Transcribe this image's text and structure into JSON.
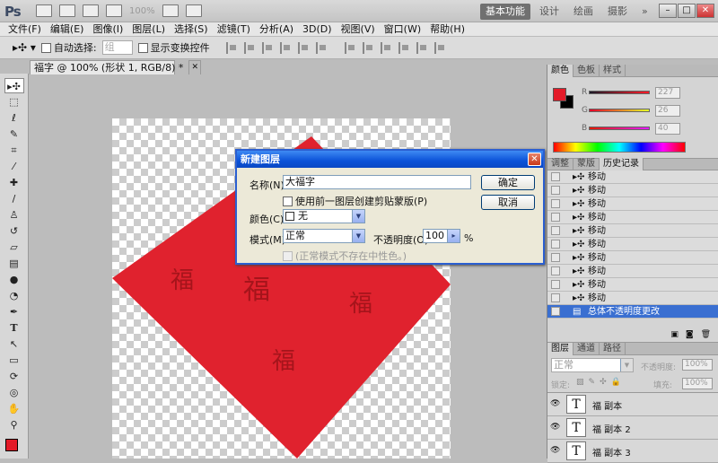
{
  "app": {
    "logo": "Ps",
    "zoom": "100%"
  },
  "workspaces": [
    "基本功能",
    "设计",
    "绘画",
    "摄影"
  ],
  "workspace_more": "»",
  "window_controls": [
    "–",
    "□",
    "✕"
  ],
  "menu": [
    "文件(F)",
    "编辑(E)",
    "图像(I)",
    "图层(L)",
    "选择(S)",
    "滤镜(T)",
    "分析(A)",
    "3D(D)",
    "视图(V)",
    "窗口(W)",
    "帮助(H)"
  ],
  "options": {
    "auto_select_label": "自动选择:",
    "auto_select_value": "组",
    "transform_label": "显示变换控件"
  },
  "document": {
    "tab_title": "福字 @ 100% (形状 1, RGB/8) *",
    "close": "✕"
  },
  "canvas": {
    "fu_char": "福",
    "shape_color": "#e0222e"
  },
  "dialog": {
    "title": "新建图层",
    "close": "✕",
    "name_label": "名称(N):",
    "name_value": "大福字",
    "clip_label": "使用前一图层创建剪贴蒙版(P)",
    "color_label": "颜色(C):",
    "color_value": "无",
    "mode_label": "模式(M):",
    "mode_value": "正常",
    "opacity_label": "不透明度(O):",
    "opacity_value": "100",
    "opacity_unit": "%",
    "neutral_label": "(正常模式不存在中性色。)",
    "ok": "确定",
    "cancel": "取消"
  },
  "color_panel": {
    "tabs": [
      "颜色",
      "色板",
      "样式"
    ],
    "channels": [
      {
        "label": "R",
        "value": "227"
      },
      {
        "label": "G",
        "value": "26"
      },
      {
        "label": "B",
        "value": "40"
      }
    ],
    "fg": "#e31a28",
    "bg": "#000000"
  },
  "history_panel": {
    "tabs": [
      "调整",
      "蒙版",
      "历史记录"
    ],
    "items": [
      "移动",
      "移动",
      "移动",
      "移动",
      "移动",
      "移动",
      "移动",
      "移动",
      "移动",
      "移动"
    ],
    "selected": "总体不透明度更改"
  },
  "layers_panel": {
    "tabs": [
      "图层",
      "通道",
      "路径"
    ],
    "blend_mode": "正常",
    "opacity_label": "不透明度:",
    "opacity_value": "100%",
    "lock_label": "锁定:",
    "fill_label": "填充:",
    "fill_value": "100%",
    "layers": [
      {
        "name": "福 副本"
      },
      {
        "name": "福 副本 2"
      },
      {
        "name": "福 副本 3"
      }
    ]
  },
  "toolbox": {
    "fg": "#e31a28",
    "bg": "#000000"
  }
}
